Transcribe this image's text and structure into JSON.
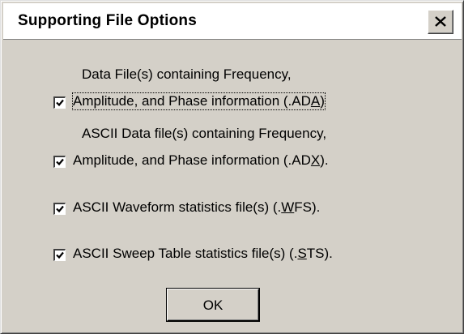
{
  "window": {
    "title": "Supporting File Options",
    "close_label": "×"
  },
  "options": [
    {
      "line1": "Data File(s) containing Frequency,",
      "line2_before": "Amplitude, and Phase information (.AD",
      "line2_accel": "A",
      "line2_after": ")",
      "checked": true
    },
    {
      "line1": "ASCII Data file(s) containing Frequency,",
      "line2_before": "Amplitude, and Phase information (.AD",
      "line2_accel": "X",
      "line2_after": ").",
      "checked": true
    },
    {
      "line2_before": "ASCII Waveform statistics file(s) (.",
      "line2_accel": "W",
      "line2_after": "FS).",
      "checked": true
    },
    {
      "line2_before": "ASCII Sweep Table statistics file(s) (.",
      "line2_accel": "S",
      "line2_after": "TS).",
      "checked": true
    }
  ],
  "buttons": {
    "ok_label": "OK"
  },
  "icons": {
    "close": "close-icon",
    "check": "check-icon"
  },
  "colors": {
    "dialog_face": "#d4d0c8",
    "title_bg": "#ffffff"
  }
}
